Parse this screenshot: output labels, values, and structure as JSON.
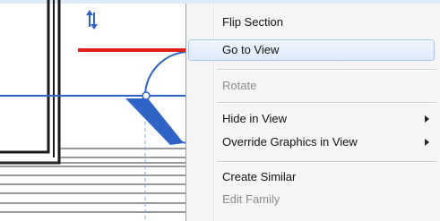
{
  "context_menu": {
    "items": [
      {
        "label": "Flip Section",
        "enabled": true,
        "submenu": false
      },
      {
        "label": "Go to View",
        "enabled": true,
        "submenu": false,
        "highlighted": true
      },
      {
        "label": "Rotate",
        "enabled": false,
        "submenu": false
      },
      {
        "label": "Hide in View",
        "enabled": true,
        "submenu": true
      },
      {
        "label": "Override Graphics in View",
        "enabled": true,
        "submenu": true
      },
      {
        "label": "Create Similar",
        "enabled": true,
        "submenu": false
      },
      {
        "label": "Edit Family",
        "enabled": false,
        "submenu": false
      }
    ]
  },
  "colors": {
    "section_line": "#2f63c6",
    "annotation_arrow": "#e0201b",
    "menu_background": "#f5f5f5",
    "page_background": "#dde9f3"
  },
  "icons": [
    "flip-arrows-icon",
    "section-head-icon",
    "red-callout-arrow"
  ]
}
